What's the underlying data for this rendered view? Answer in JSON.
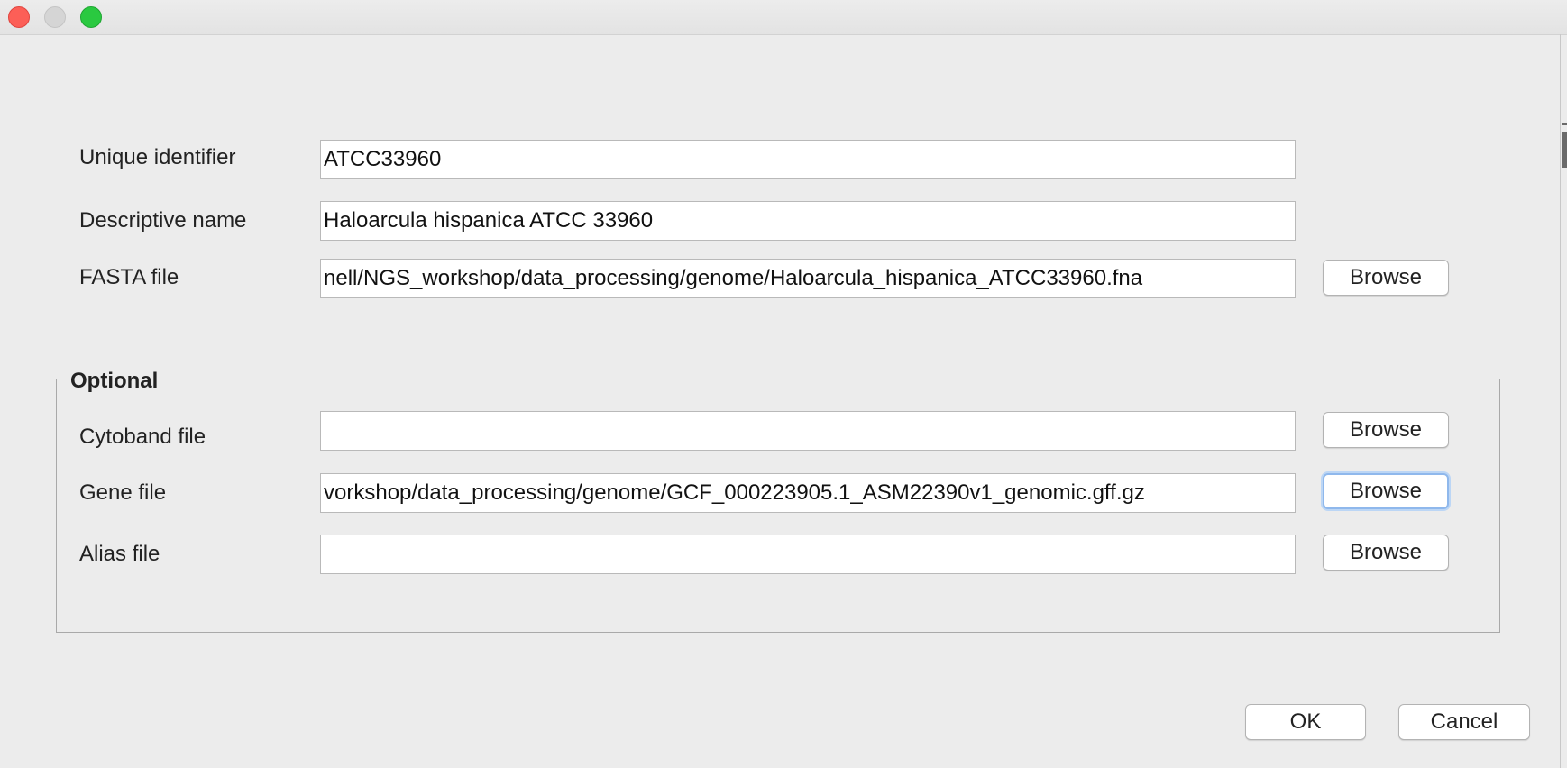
{
  "window": {
    "controls": [
      "close",
      "minimize",
      "maximize"
    ]
  },
  "form": {
    "unique_identifier": {
      "label": "Unique identifier",
      "value": "ATCC33960"
    },
    "descriptive_name": {
      "label": "Descriptive name",
      "value": "Haloarcula hispanica ATCC 33960"
    },
    "fasta_file": {
      "label": "FASTA file",
      "value": "nell/NGS_workshop/data_processing/genome/Haloarcula_hispanica_ATCC33960.fna",
      "browse_label": "Browse"
    }
  },
  "optional": {
    "title": "Optional",
    "cytoband_file": {
      "label": "Cytoband file",
      "value": "",
      "browse_label": "Browse"
    },
    "gene_file": {
      "label": "Gene file",
      "value": "vorkshop/data_processing/genome/GCF_000223905.1_ASM22390v1_genomic.gff.gz",
      "browse_label": "Browse"
    },
    "alias_file": {
      "label": "Alias file",
      "value": "",
      "browse_label": "Browse"
    }
  },
  "actions": {
    "ok_label": "OK",
    "cancel_label": "Cancel"
  }
}
